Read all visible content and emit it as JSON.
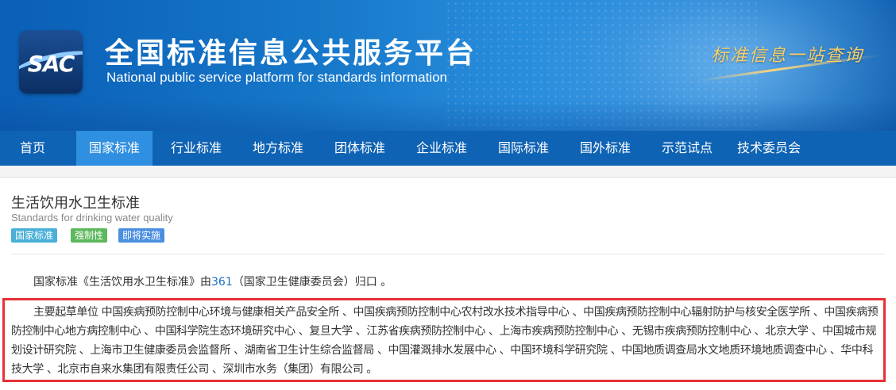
{
  "header": {
    "logo_text": "SAC",
    "title_cn": "全国标准信息公共服务平台",
    "title_en": "National public service platform  for standards information",
    "slogan": "标准信息一站查询"
  },
  "nav": {
    "items": [
      {
        "label": "首页"
      },
      {
        "label": "国家标准",
        "active": true
      },
      {
        "label": "行业标准"
      },
      {
        "label": "地方标准"
      },
      {
        "label": "团体标准"
      },
      {
        "label": "企业标准"
      },
      {
        "label": "国际标准"
      },
      {
        "label": "国外标准"
      },
      {
        "label": "示范试点"
      },
      {
        "label": "技术委员会"
      }
    ]
  },
  "standard": {
    "title": "生活饮用水卫生标准",
    "title_en": "Standards for drinking water quality",
    "badges": [
      {
        "label": "国家标准",
        "color": "#4ab0d8"
      },
      {
        "label": "强制性",
        "color": "#5cb85c"
      },
      {
        "label": "即将实施",
        "color": "#4b8fe0"
      }
    ],
    "ownership": {
      "prefix": "国家标准《生活饮用水卫生标准》由",
      "tc_number": "361",
      "suffix": "（国家卫生健康委员会）归口 。"
    },
    "drafters_text": "主要起草单位 中国疾病预防控制中心环境与健康相关产品安全所 、中国疾病预防控制中心农村改水技术指导中心 、中国疾病预防控制中心辐射防护与核安全医学所 、中国疾病预防控制中心地方病控制中心 、中国科学院生态环境研究中心 、复旦大学 、江苏省疾病预防控制中心 、上海市疾病预防控制中心 、无锡市疾病预防控制中心 、北京大学 、中国城市规划设计研究院 、上海市卫生健康委员会监督所 、湖南省卫生计生综合监督局 、中国灌溉排水发展中心 、中国环境科学研究院 、中国地质调查局水文地质环境地质调查中心 、华中科技大学 、北京市自来水集团有限责任公司 、深圳市水务（集团）有限公司 。"
  }
}
